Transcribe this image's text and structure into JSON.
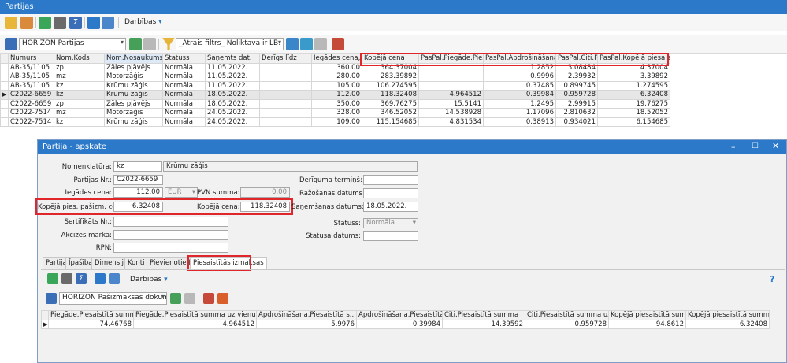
{
  "window": {
    "title": "Partijas"
  },
  "toolbar": {
    "actions_label": "Darbības"
  },
  "filterbar": {
    "source_combo": "HORIZON Partijas",
    "filter_combo": "_Ātrais filtrs_ Noliktava ir LB: Lauku b"
  },
  "grid": {
    "columns": [
      "Numurs",
      "Nom.Kods",
      "Nom.Nosaukums",
      "Statuss",
      "Saņemts dat.",
      "Derīgs līdz",
      "Iegādes cena,...",
      "Kopējā cena",
      "PasPal.Piegāde.Pies...",
      "PasPal.Apdrošināšana....",
      "PasPal.Citi.P...",
      "PasPal.Kopējā piesaistīt..."
    ],
    "rows": [
      [
        "AB-35/1105",
        "zp",
        "Zāles pļāvējs",
        "Normāla",
        "11.05.2022.",
        "",
        "360.00",
        "364.37004",
        "",
        "1.2852",
        "3.08484",
        "4.37004"
      ],
      [
        "AB-35/1105",
        "mz",
        "Motorzāģis",
        "Normāla",
        "11.05.2022.",
        "",
        "280.00",
        "283.39892",
        "",
        "0.9996",
        "2.39932",
        "3.39892"
      ],
      [
        "AB-35/1105",
        "kz",
        "Krūmu zāģis",
        "Normāla",
        "11.05.2022.",
        "",
        "105.00",
        "106.274595",
        "",
        "0.37485",
        "0.899745",
        "1.274595"
      ],
      [
        "C2022-6659",
        "kz",
        "Krūmu zāģis",
        "Normāla",
        "18.05.2022.",
        "",
        "112.00",
        "118.32408",
        "4.964512",
        "0.39984",
        "0.959728",
        "6.32408"
      ],
      [
        "C2022-6659",
        "zp",
        "Zāles pļāvējs",
        "Normāla",
        "18.05.2022.",
        "",
        "350.00",
        "369.76275",
        "15.5141",
        "1.2495",
        "2.99915",
        "19.76275"
      ],
      [
        "C2022-7514",
        "mz",
        "Motorzāģis",
        "Normāla",
        "24.05.2022.",
        "",
        "328.00",
        "346.52052",
        "14.538928",
        "1.17096",
        "2.810632",
        "18.52052"
      ],
      [
        "C2022-7514",
        "kz",
        "Krūmu zāģis",
        "Normāla",
        "24.05.2022.",
        "",
        "109.00",
        "115.154685",
        "4.831534",
        "0.38913",
        "0.934021",
        "6.154685"
      ]
    ]
  },
  "dialog": {
    "title": "Partija - apskate",
    "fields": {
      "nomenklatura_label": "Nomenklatūra:",
      "nomenklatura_code": "kz",
      "nomenklatura_name": "Krūmu zāģis",
      "partijas_nr_label": "Partijas Nr.:",
      "partijas_nr": "C2022-6659",
      "iegades_cena_label": "Iegādes cena:",
      "iegades_cena": "112.00",
      "currency": "EUR",
      "pvn_summa_label": "PVN summa:",
      "pvn_summa": "0.00",
      "kopeja_pies_label": "Kopējā pies. pašizm. cena:",
      "kopeja_pies": "6.32408",
      "kopeja_cena_label": "Kopējā cena:",
      "kopeja_cena": "118.32408",
      "sertifikats_label": "Sertifikāts Nr.:",
      "akcizes_label": "Akcīzes marka:",
      "rpn_label": "RPN:",
      "deriguma_label": "Derīguma termiņš:",
      "razosanas_label": "Ražošanas datums:",
      "sanemsanas_label": "Saņemšanas datums:",
      "sanemsanas": "18.05.2022.",
      "statuss_label": "Statuss:",
      "statuss": "Normāla",
      "statusa_datums_label": "Statusa datums:"
    },
    "tabs": [
      "Partija",
      "Īpašības",
      "Dimensijas",
      "Konti",
      "Pievienotie faili",
      "Piesaistītās izmaksas"
    ],
    "actions_label": "Darbības",
    "source_combo": "HORIZON Pašizmaksas dokumentu ri",
    "subgrid": {
      "columns": [
        "Piegāde.Piesaistītā summa",
        "Piegāde.Piesaistītā summa uz vienu vienību",
        "Apdrošināšana.Piesaistītā s...",
        "Apdrošināšana.Piesaistītā s...",
        "Citi.Piesaistītā summa",
        "Citi.Piesaistītā summa uz vie...",
        "Kopējā piesaistītā summa",
        "Kopējā piesaistītā summa uz..."
      ],
      "row": [
        "74.46768",
        "4.964512",
        "5.9976",
        "0.39984",
        "14.39592",
        "0.959728",
        "94.8612",
        "6.32408"
      ]
    }
  }
}
